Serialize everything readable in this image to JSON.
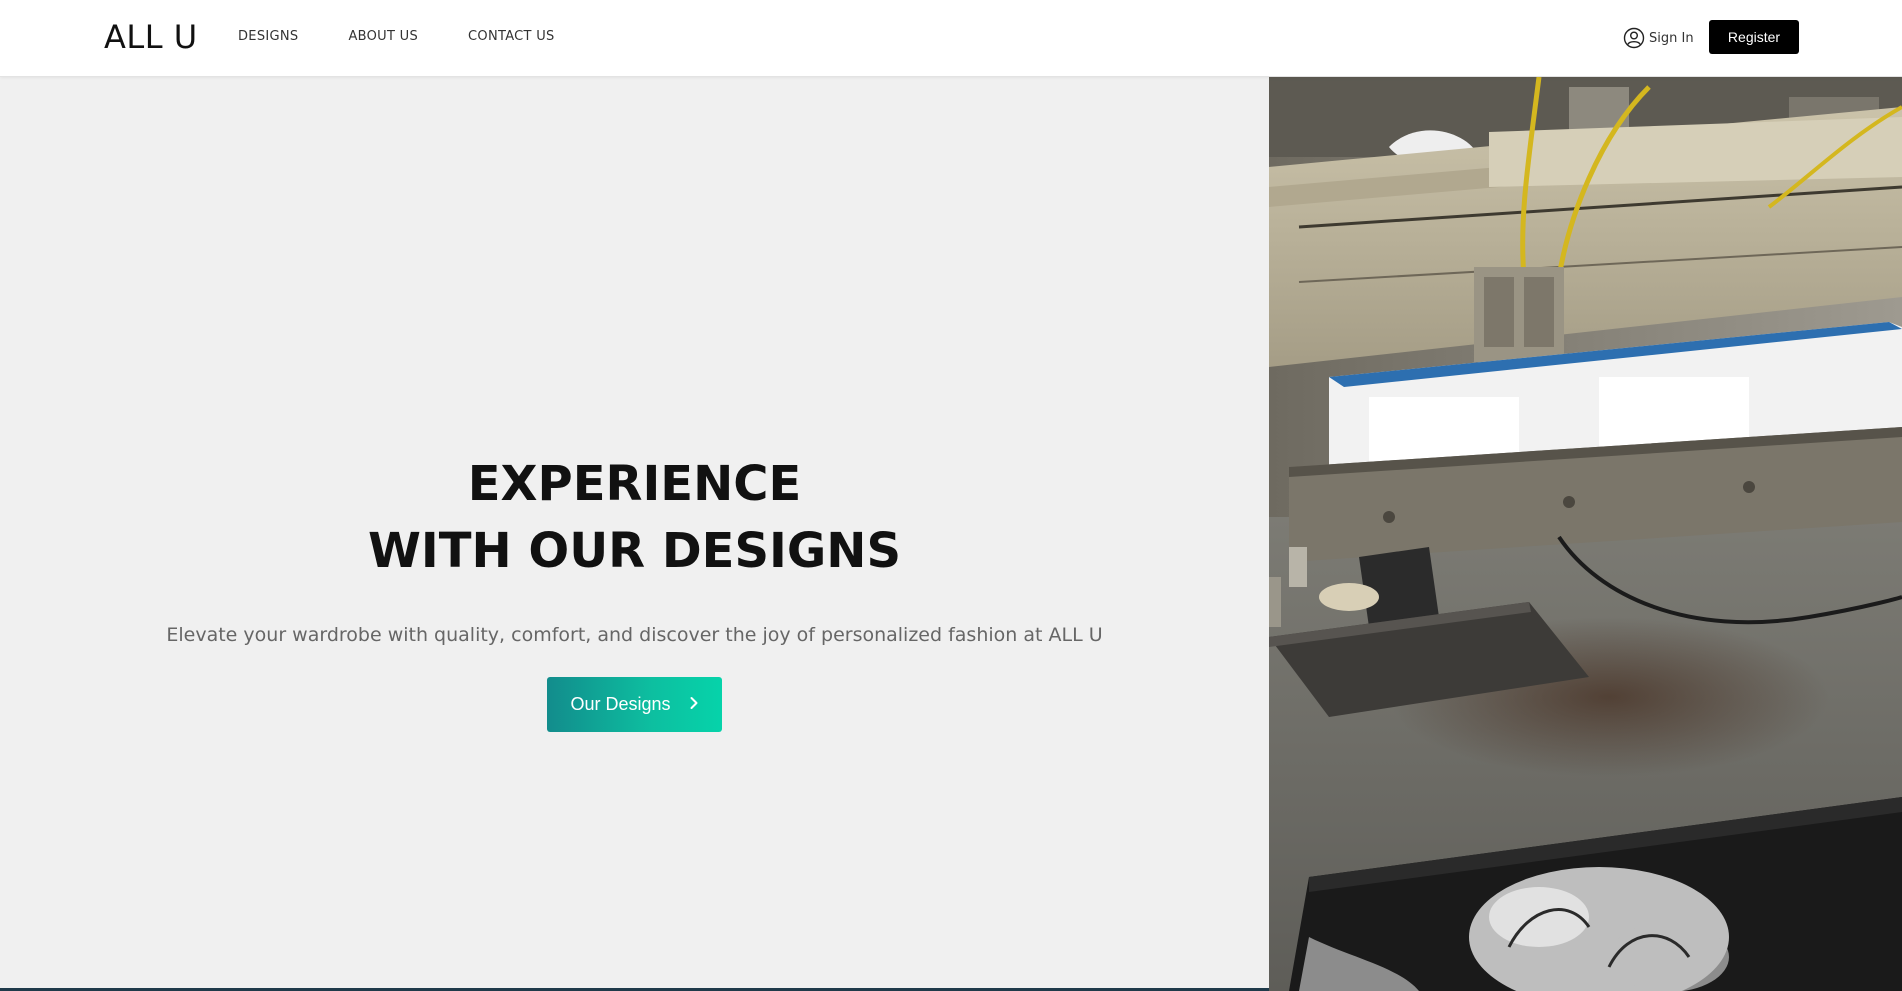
{
  "header": {
    "logo": "ALL U",
    "nav": [
      "DESIGNS",
      "ABOUT US",
      "CONTACT US"
    ],
    "signin_label": "Sign In",
    "register_label": "Register"
  },
  "hero": {
    "title_line1": "EXPERIENCE",
    "title_line2": "WITH OUR DESIGNS",
    "subtitle": "Elevate your wardrobe with quality, comfort, and discover the joy of personalized fashion at ALL U",
    "cta_label": "Our Designs",
    "cta_icon": "chevron-right-icon",
    "image_subject": "screen-printing press over a black t-shirt"
  },
  "colors": {
    "hero_bg": "#f0f0f0",
    "cta_gradient_start": "#128c8c",
    "cta_gradient_end": "#06d3aa",
    "register_bg": "#000000"
  }
}
